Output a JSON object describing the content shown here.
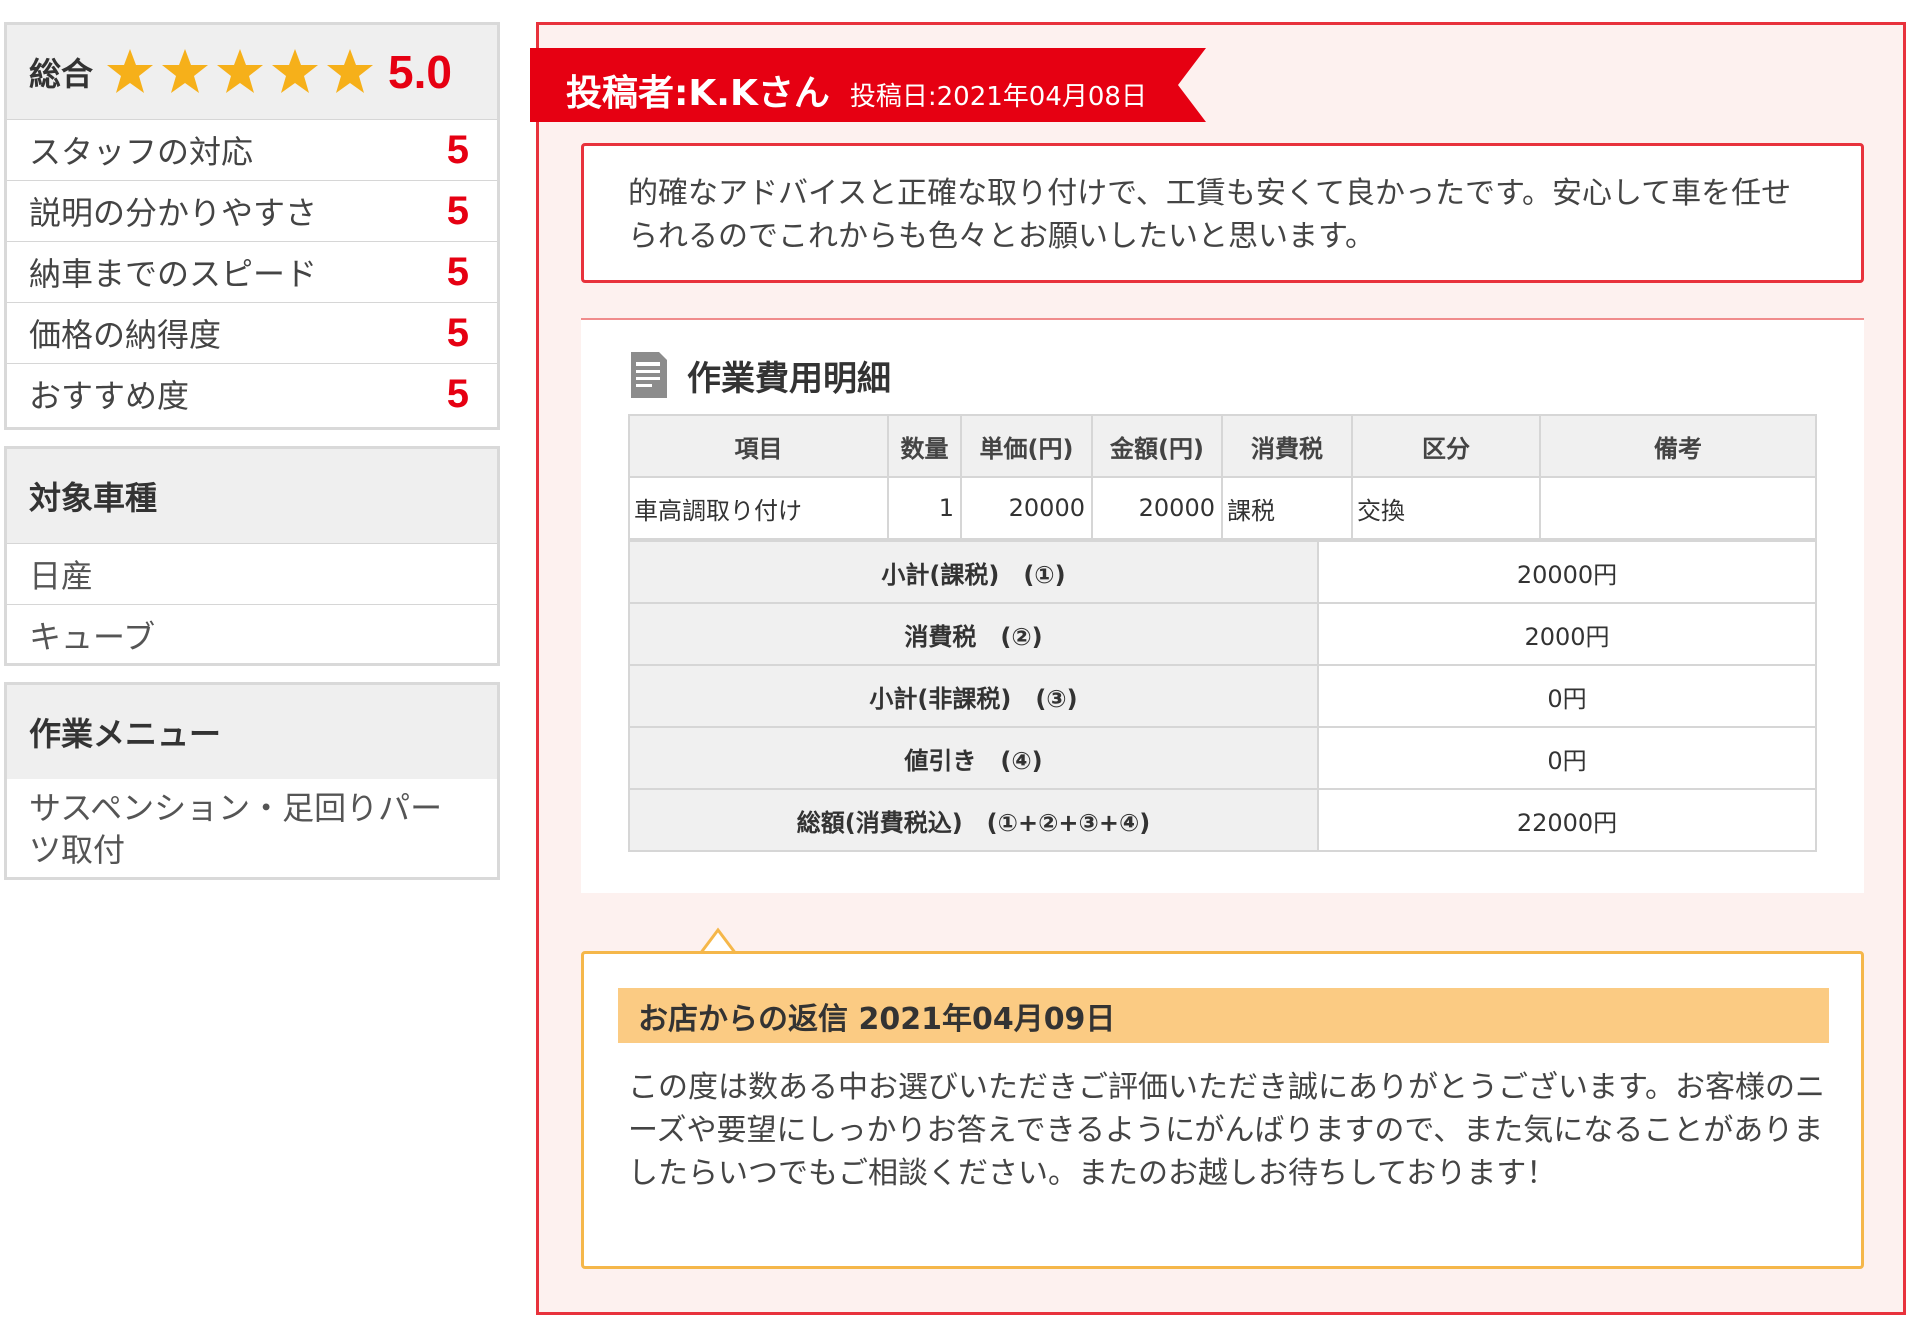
{
  "rating": {
    "overall_label": "総合",
    "overall_score": "5.0",
    "star_count": 5,
    "star_color": "#f6b01a",
    "items": [
      {
        "label": "スタッフの対応",
        "value": "5"
      },
      {
        "label": "説明の分かりやすさ",
        "value": "5"
      },
      {
        "label": "納車までのスピード",
        "value": "5"
      },
      {
        "label": "価格の納得度",
        "value": "5"
      },
      {
        "label": "おすすめ度",
        "value": "5"
      }
    ]
  },
  "vehicle": {
    "heading": "対象車種",
    "maker": "日産",
    "model": "キューブ"
  },
  "work_menu": {
    "heading": "作業メニュー",
    "item": "サスペンション・足回りパーツ取付"
  },
  "review": {
    "poster": "投稿者:K.Kさん",
    "posted_date": "投稿日:2021年04月08日",
    "comment": "的確なアドバイスと正確な取り付けで、工賃も安くて良かったです。安心して車を任せられるのでこれからも色々とお願いしたいと思います。"
  },
  "cost": {
    "title": "作業費用明細",
    "headers": [
      "項目",
      "数量",
      "単価(円)",
      "金額(円)",
      "消費税",
      "区分",
      "備考"
    ],
    "rows": [
      [
        "車高調取り付け",
        "1",
        "20000",
        "20000",
        "課税",
        "交換",
        ""
      ]
    ],
    "totals": [
      {
        "label": "小計(課税)　(①)",
        "value": "20000円"
      },
      {
        "label": "消費税　(②)",
        "value": "2000円"
      },
      {
        "label": "小計(非課税)　(③)",
        "value": "0円"
      },
      {
        "label": "値引き　(④)",
        "value": "0円"
      },
      {
        "label": "総額(消費税込)　(①+②+③+④)",
        "value": "22000円"
      }
    ]
  },
  "reply": {
    "heading": "お店からの返信 2021年04月09日",
    "body": "この度は数ある中お選びいただきご評価いただき誠にありがとうございます。お客様のニーズや要望にしっかりお答えできるようにがんばりますので、また気になることがありましたらいつでもご相談ください。またのお越しお待ちしております！"
  },
  "colors": {
    "accent_red": "#e60012",
    "reply_orange": "#f5b74a",
    "reply_header": "#fbcb83"
  }
}
